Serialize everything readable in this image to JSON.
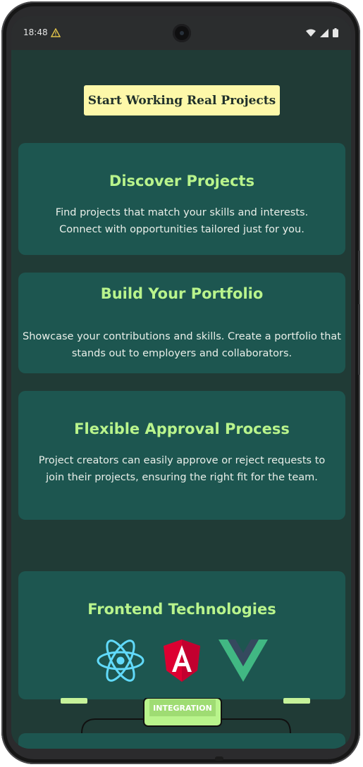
{
  "status_bar": {
    "time": "18:48",
    "icons": [
      "warning-icon",
      "wifi-icon",
      "signal-icon",
      "battery-icon"
    ]
  },
  "cta": {
    "label": "Start Working Real Projects"
  },
  "features": [
    {
      "title": "Discover Projects",
      "description": "Find projects that match your skills and interests. Connect with opportunities tailored just for you."
    },
    {
      "title": "Build Your Portfolio",
      "description": "Showcase your contributions and skills. Create a portfolio that stands out to employers and collaborators."
    },
    {
      "title": "Flexible Approval Process",
      "description": "Project creators can easily approve or reject requests to join their projects, ensuring the right fit for the team."
    }
  ],
  "technologies": {
    "title": "Frontend Technologies",
    "icons": [
      "react-icon",
      "angular-icon",
      "vue-icon"
    ]
  },
  "illustration": {
    "label": "INTEGRATION"
  },
  "colors": {
    "background": "#203b36",
    "card": "#1d5650",
    "accent": "#b9f48c",
    "cta_background": "#fdf8a9"
  }
}
